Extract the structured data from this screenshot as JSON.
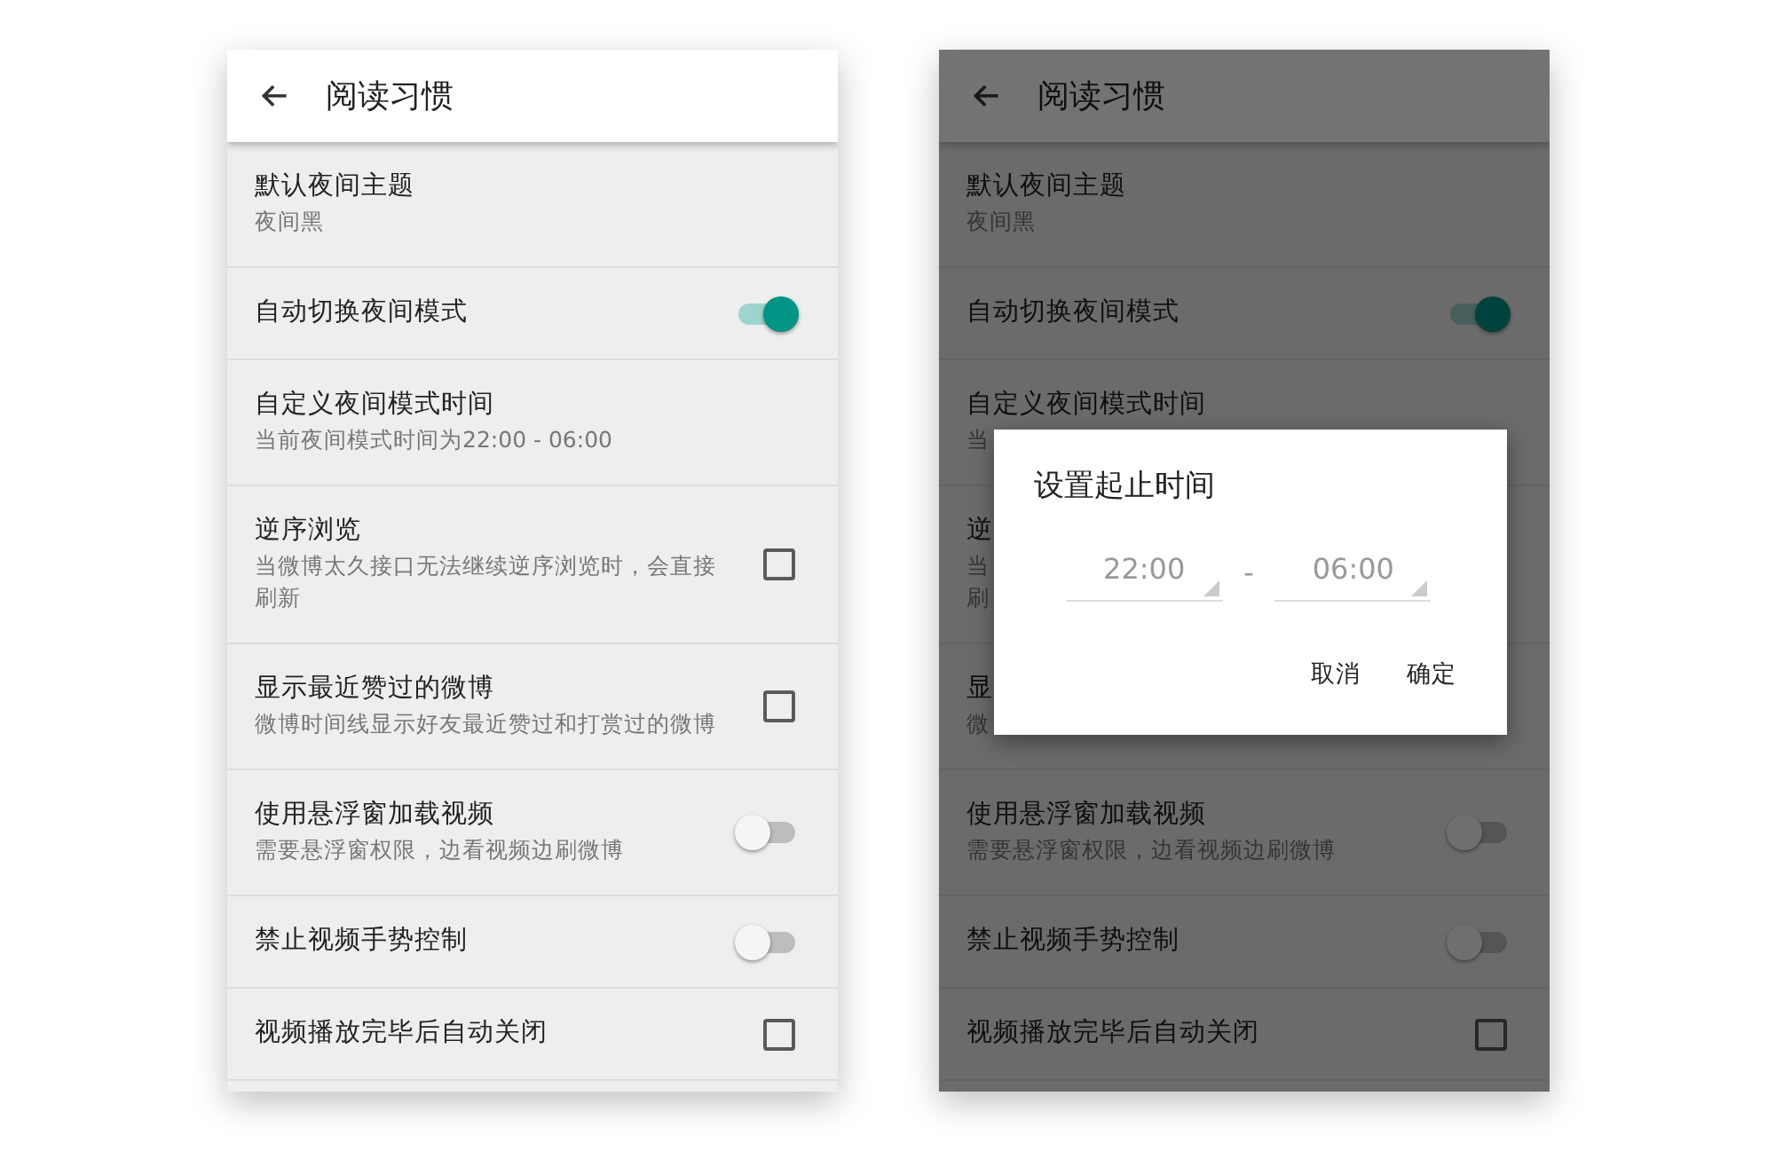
{
  "screens": [
    {
      "dimmed": false,
      "header": {
        "title": "阅读习惯"
      },
      "rows": [
        {
          "title": "默认夜间主题",
          "subtitle": [
            "夜间黑"
          ]
        },
        {
          "title": "自动切换夜间模式",
          "control": {
            "kind": "switch",
            "on": true
          }
        },
        {
          "title": "自定义夜间模式时间",
          "subtitle": [
            "当前夜间模式时间为22:00 - 06:00"
          ]
        },
        {
          "title": "逆序浏览",
          "subtitle": [
            "当微博太久接口无法继续逆序浏览时，会直接刷新"
          ],
          "control": {
            "kind": "checkbox",
            "checked": false
          }
        },
        {
          "title": "显示最近赞过的微博",
          "subtitle": [
            "微博时间线显示好友最近赞过和打赏过的微博"
          ],
          "control": {
            "kind": "checkbox",
            "checked": false
          }
        },
        {
          "title": "使用悬浮窗加载视频",
          "subtitle": [
            "需要悬浮窗权限，边看视频边刷微博"
          ],
          "control": {
            "kind": "switch",
            "on": false
          }
        },
        {
          "title": "禁止视频手势控制",
          "control": {
            "kind": "switch",
            "on": false
          }
        },
        {
          "title": "视频播放完毕后自动关闭",
          "control": {
            "kind": "checkbox",
            "checked": false
          }
        }
      ]
    },
    {
      "dimmed": true,
      "header": {
        "title": "阅读习惯"
      },
      "rows": [
        {
          "title": "默认夜间主题",
          "subtitle": [
            "夜间黑"
          ]
        },
        {
          "title": "自动切换夜间模式",
          "control": {
            "kind": "switch",
            "on": true
          }
        },
        {
          "title": "自定义夜间模式时间",
          "subtitle": [
            "当"
          ]
        },
        {
          "title": "逆",
          "subtitle": [
            "当",
            "刷"
          ]
        },
        {
          "title": "显",
          "subtitle": [
            "微"
          ]
        },
        {
          "title": "使用悬浮窗加载视频",
          "subtitle": [
            "需要悬浮窗权限，边看视频边刷微博"
          ],
          "control": {
            "kind": "switch",
            "on": false
          }
        },
        {
          "title": "禁止视频手势控制",
          "control": {
            "kind": "switch",
            "on": false
          }
        },
        {
          "title": "视频播放完毕后自动关闭",
          "control": {
            "kind": "checkbox",
            "checked": false
          }
        }
      ],
      "dialog": {
        "title": "设置起止时间",
        "start": "22:00",
        "separator": "-",
        "end": "06:00",
        "buttons": [
          "取消",
          "确定"
        ]
      }
    }
  ]
}
